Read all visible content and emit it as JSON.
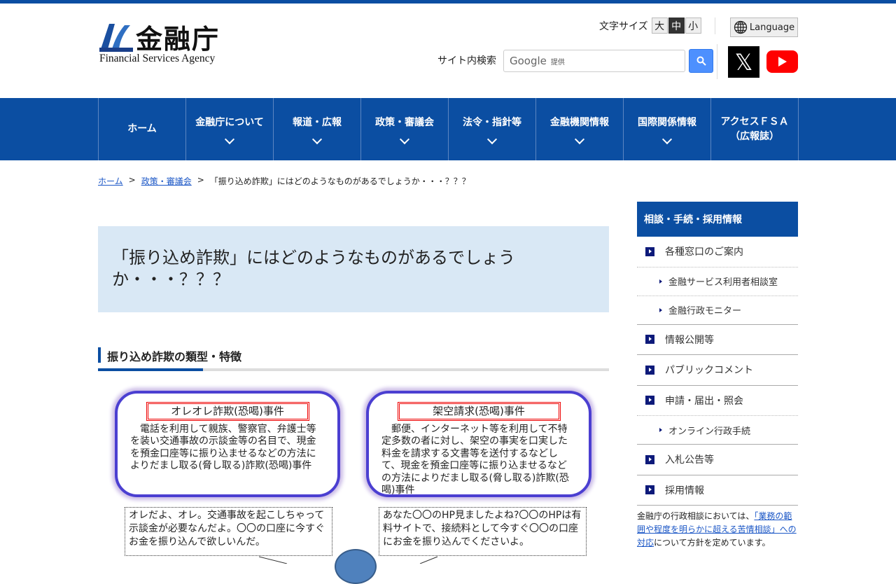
{
  "header": {
    "logo_kanji": "金融庁",
    "logo_en": "Financial Services Agency",
    "font_size_label": "文字サイズ",
    "font_sizes": [
      "大",
      "中",
      "小"
    ],
    "language": "Language",
    "search_label": "サイト内検索",
    "search_placeholder": "Google",
    "search_provided": "提供"
  },
  "nav": [
    "ホーム",
    "金融庁について",
    "報道・広報",
    "政策・審議会",
    "法令・指針等",
    "金融機関情報",
    "国際関係情報",
    "アクセスＦＳＡ",
    "（広報誌）"
  ],
  "breadcrumb": [
    "ホーム",
    "政策・審議会",
    "「振り込め詐欺」にはどのようなものがあるでしょうか・・・？？？"
  ],
  "page_title": "「振り込め詐欺」にはどのようなものがあるでしょうか・・・？？？",
  "section_heading": "振り込め詐欺の類型・特徴",
  "cards": [
    {
      "title": "オレオレ詐欺(恐喝)事件",
      "body": "　電話を利用して親族、警察官、弁護士等を装い交通事故の示談金等の名目で、現金を預金口座等に振り込ませるなどの方法によりだまし取る(脅し取る)詐欺(恐喝)事件",
      "bubble": "オレだよ、オレ。交通事故を起こしちゃって示談金が必要なんだよ。〇〇の口座に今すぐお金を振り込んで欲しいんだ。"
    },
    {
      "title": "架空請求(恐喝)事件",
      "body": "　郵便、インターネット等を利用して不特定多数の者に対し、架空の事実を口実した料金を請求する文書等を送付するなどして、現金を預金口座等に振り込ませるなどの方法によりだまし取る(脅し取る)詐欺(恐喝)事件",
      "bubble": "あなた〇〇のHP見ましたよね?〇〇のHPは有料サイトで、接続料として今すぐ〇〇の口座にお金を振り込んでくださいよ。"
    }
  ],
  "sidebar": {
    "heading": "相談・手続・採用情報",
    "items": [
      "各種窓口のご案内",
      "金融サービス利用者相談室",
      "金融行政モニター",
      "情報公開等",
      "パブリックコメント",
      "申請・届出・照会",
      "オンライン行政手続",
      "入札公告等",
      "採用情報"
    ],
    "note_pre": "金融庁の行政相談においては、",
    "note_link": "「業務の範囲や程度を明らかに超える苦情相談」への対応",
    "note_post": "について方針を定めています。"
  }
}
